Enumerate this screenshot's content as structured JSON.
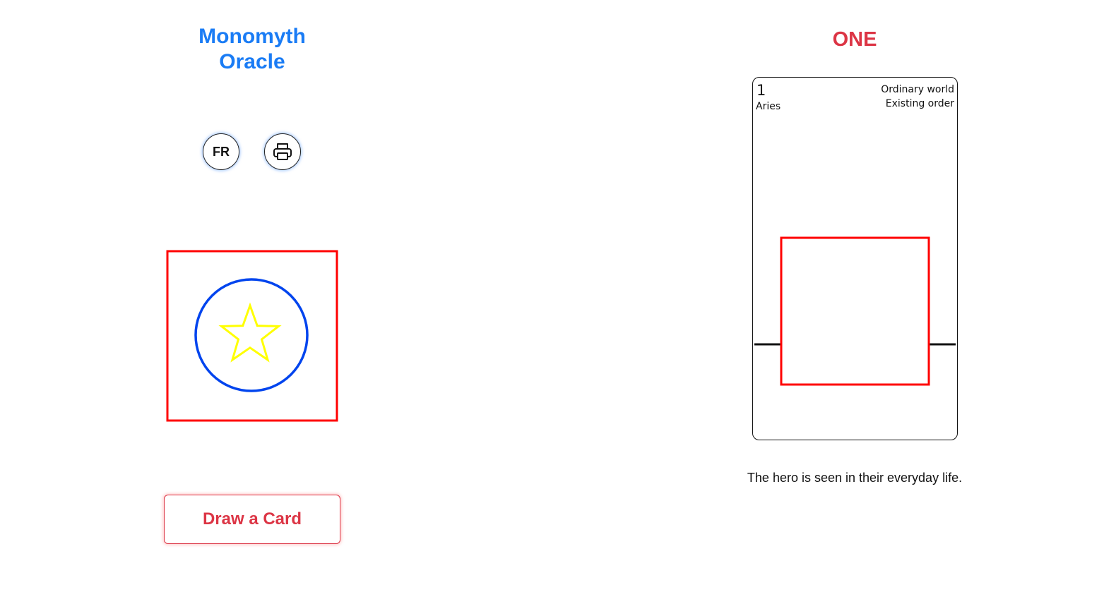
{
  "app": {
    "title_line1": "Monomyth",
    "title_line2": "Oracle"
  },
  "controls": {
    "language_button": "FR",
    "print_icon": "printer-icon",
    "draw_button": "Draw a Card"
  },
  "card_back": {
    "icon": "star-icon",
    "colors": {
      "frame": "#ff0000",
      "circle": "#0044ee",
      "star": "#ffff00"
    }
  },
  "current_card": {
    "title": "ONE",
    "number": "1",
    "sign": "Aries",
    "stage_line1": "Ordinary world",
    "stage_line2": "Existing order",
    "description": "The hero is seen in their everyday life."
  },
  "colors": {
    "brand_blue": "#1a7cf5",
    "accent_red": "#dc3545"
  }
}
